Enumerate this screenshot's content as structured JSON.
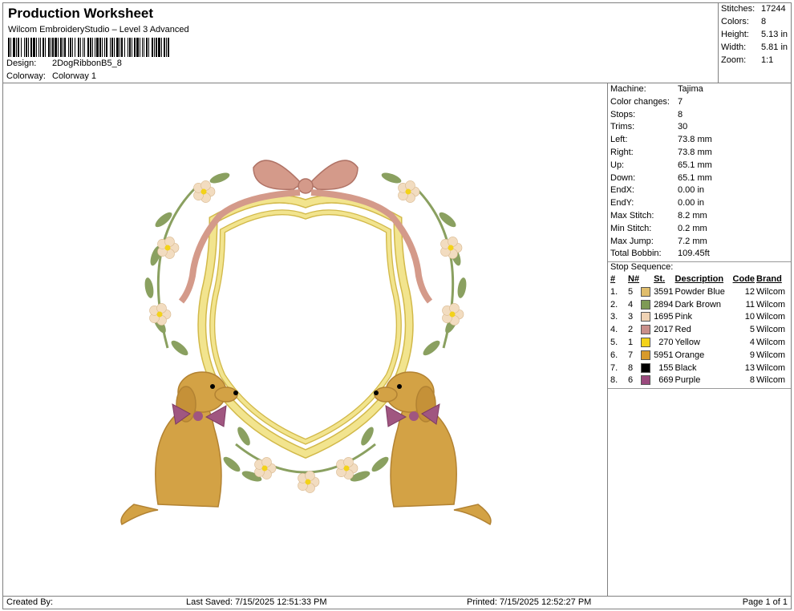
{
  "header": {
    "title": "Production Worksheet",
    "software": "Wilcom EmbroideryStudio – Level 3 Advanced",
    "design_label": "Design:",
    "design_value": "2DogRibbonB5_8",
    "colorway_label": "Colorway:",
    "colorway_value": "Colorway 1"
  },
  "stats": [
    {
      "label": "Stitches:",
      "value": "17244"
    },
    {
      "label": "Colors:",
      "value": "8"
    },
    {
      "label": "Height:",
      "value": "5.13 in"
    },
    {
      "label": "Width:",
      "value": "5.81 in"
    },
    {
      "label": "Zoom:",
      "value": "1:1"
    }
  ],
  "machine": [
    {
      "label": "Machine:",
      "value": "Tajima"
    },
    {
      "label": "Color changes:",
      "value": "7"
    },
    {
      "label": "Stops:",
      "value": "8"
    },
    {
      "label": "Trims:",
      "value": "30"
    },
    {
      "label": "Left:",
      "value": "73.8 mm"
    },
    {
      "label": "Right:",
      "value": "73.8 mm"
    },
    {
      "label": "Up:",
      "value": "65.1 mm"
    },
    {
      "label": "Down:",
      "value": "65.1 mm"
    },
    {
      "label": "EndX:",
      "value": "0.00 in"
    },
    {
      "label": "EndY:",
      "value": "0.00 in"
    },
    {
      "label": "Max Stitch:",
      "value": "8.2 mm"
    },
    {
      "label": "Min Stitch:",
      "value": "0.2 mm"
    },
    {
      "label": "Max Jump:",
      "value": "7.2 mm"
    },
    {
      "label": "Total Bobbin:",
      "value": "109.45ft"
    }
  ],
  "stop_sequence": {
    "title": "Stop Sequence:",
    "headers": [
      "#",
      "N#",
      "St.",
      "Description",
      "Code",
      "Brand"
    ],
    "rows": [
      {
        "num": "1.",
        "n": "5",
        "color": "#e0bd6c",
        "st": "3591",
        "desc": "Powder Blue",
        "code": "12",
        "brand": "Wilcom"
      },
      {
        "num": "2.",
        "n": "4",
        "color": "#7e9a55",
        "st": "2894",
        "desc": "Dark Brown",
        "code": "11",
        "brand": "Wilcom"
      },
      {
        "num": "3.",
        "n": "3",
        "color": "#f0d3b4",
        "st": "1695",
        "desc": "Pink",
        "code": "10",
        "brand": "Wilcom"
      },
      {
        "num": "4.",
        "n": "2",
        "color": "#c98f8a",
        "st": "2017",
        "desc": "Red",
        "code": "5",
        "brand": "Wilcom"
      },
      {
        "num": "5.",
        "n": "1",
        "color": "#f3d21a",
        "st": "270",
        "desc": "Yellow",
        "code": "4",
        "brand": "Wilcom"
      },
      {
        "num": "6.",
        "n": "7",
        "color": "#d79a2c",
        "st": "5951",
        "desc": "Orange",
        "code": "9",
        "brand": "Wilcom"
      },
      {
        "num": "7.",
        "n": "8",
        "color": "#000000",
        "st": "155",
        "desc": "Black",
        "code": "13",
        "brand": "Wilcom"
      },
      {
        "num": "8.",
        "n": "6",
        "color": "#9b4a7e",
        "st": "669",
        "desc": "Purple",
        "code": "8",
        "brand": "Wilcom"
      }
    ]
  },
  "footer": {
    "created_by": "Created By:",
    "last_saved": "Last Saved: 7/15/2025 12:51:33 PM",
    "printed": "Printed: 7/15/2025 12:52:27 PM",
    "page": "Page 1 of 1"
  },
  "thread_colors": {
    "frame_yellow": "#f2e48e",
    "frame_dark": "#d2b94a",
    "leaf_green": "#8aa060",
    "flower_cream": "#f2dcc0",
    "ribbon_pink": "#d49a8a",
    "dog_gold": "#d3a245",
    "bow_purple": "#a05680"
  }
}
